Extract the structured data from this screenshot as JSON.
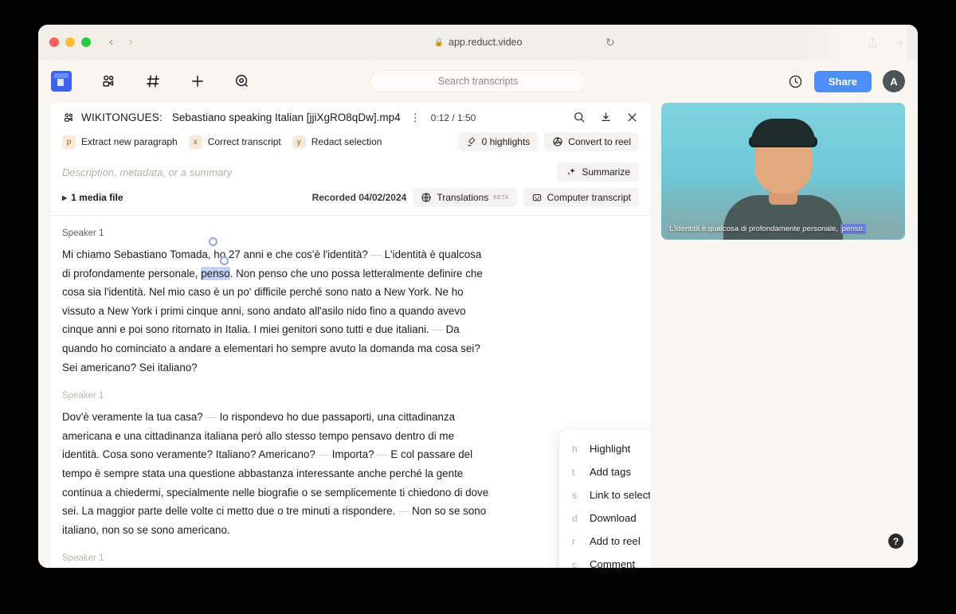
{
  "browser": {
    "url": "app.reduct.video",
    "lock_icon": "lock-icon",
    "back_icon": "chevron-left-icon",
    "forward_icon": "chevron-right-icon",
    "reload_icon": "reload-icon",
    "share_icon": "share-icon",
    "newtab_icon": "plus-icon"
  },
  "app_header": {
    "logo_name": "reduct-logo",
    "icons": [
      "team-icon",
      "hash-icon",
      "plus-icon",
      "explore-icon"
    ],
    "search_placeholder": "Search transcripts",
    "history_icon": "clock-icon",
    "share_label": "Share",
    "avatar_initial": "A",
    "accent_color": "#4e8ef7"
  },
  "document": {
    "project_prefix": "WIKITONGUES:",
    "file_name": "Sebastiano speaking Italian [jjiXgRO8qDw].mp4",
    "time_current": "0:12",
    "time_total": "1:50",
    "time_display": "0:12 / 1:50",
    "actions": [
      "search-icon",
      "download-icon",
      "close-icon"
    ]
  },
  "shortcuts": [
    {
      "key": "p",
      "label": "Extract new paragraph"
    },
    {
      "key": "x",
      "label": "Correct transcript"
    },
    {
      "key": "y",
      "label": "Redact selection"
    }
  ],
  "toolbar_right": {
    "highlights_label": "0 highlights",
    "highlights_icon": "highlighter-icon",
    "convert_label": "Convert to reel",
    "convert_icon": "reel-icon"
  },
  "description": {
    "placeholder": "Description, metadata, or a summary",
    "summarize_label": "Summarize",
    "summarize_icon": "sparkle-icon"
  },
  "meta": {
    "media_file_label": "1 media file",
    "disclosure_icon": "triangle-right-icon",
    "recorded_label": "Recorded 04/02/2024",
    "translations_label": "Translations",
    "translations_badge": "BETA",
    "translations_icon": "globe-icon",
    "computer_transcript_label": "Computer transcript",
    "computer_transcript_icon": "robot-icon"
  },
  "transcript": {
    "paragraphs": [
      {
        "speaker": "Speaker 1",
        "speaker_dim": false,
        "segments": [
          {
            "text": "Mi chiamo Sebastiano Tomada, ho 27 anni e che cos'è l'identità?",
            "style": "normal"
          },
          {
            "text": " ",
            "style": "gap"
          },
          {
            "text": "L'identità è qualcosa di profondamente personale, ",
            "style": "normal"
          },
          {
            "text": "penso",
            "style": "selected"
          },
          {
            "text": ". Non penso che uno possa letteralmente definire che cosa sia l'identità. Nel mio caso è un po' difficile perché sono nato a New York. Ne ho vissuto a New York i primi cinque anni, sono andato all'asilo nido fino a quando avevo cinque anni e poi sono ritornato in Italia. I miei genitori sono tutti e due italiani.",
            "style": "normal"
          },
          {
            "text": " ",
            "style": "gap"
          },
          {
            "text": "Da quando ho cominciato a andare a elementari ho sempre avuto la domanda ma cosa sei? Sei americano? Sei italiano?",
            "style": "normal"
          }
        ]
      },
      {
        "speaker": "Speaker 1",
        "speaker_dim": true,
        "segments": [
          {
            "text": "Dov'è veramente la tua casa?",
            "style": "normal"
          },
          {
            "text": " ",
            "style": "gap"
          },
          {
            "text": "Io rispondevo ho due passaporti, una cittadinanza americana e una cittadinanza italiana però allo stesso tempo pensavo dentro di me identità. Cosa sono veramente? Italiano? Americano?",
            "style": "normal"
          },
          {
            "text": " ",
            "style": "gap"
          },
          {
            "text": "Importa?",
            "style": "normal"
          },
          {
            "text": " ",
            "style": "gap"
          },
          {
            "text": "E col passare del tempo è sempre stata una questione abbastanza interessante anche perché la gente continua a chiedermi, specialmente nelle biografie o se semplicemente ti chiedono di dove sei. La maggior parte delle volte ci metto due o tre minuti a rispondere.",
            "style": "normal"
          },
          {
            "text": " ",
            "style": "gap"
          },
          {
            "text": "Non so se sono italiano, non so se sono americano.",
            "style": "normal"
          }
        ]
      },
      {
        "speaker": "Speaker 1",
        "speaker_dim": true,
        "segments": []
      }
    ],
    "selection_color": "#c3d2f7"
  },
  "context_menu": [
    {
      "key": "h",
      "label": "Highlight"
    },
    {
      "key": "t",
      "label": "Add tags"
    },
    {
      "key": "s",
      "label": "Link to selection"
    },
    {
      "key": "d",
      "label": "Download"
    },
    {
      "key": "r",
      "label": "Add to reel"
    },
    {
      "key": "c",
      "label": "Comment"
    }
  ],
  "video": {
    "caption_before": "L'identità è qualcosa di profondamente personale, ",
    "caption_highlight": "penso.",
    "caption_highlight_color": "#6b7fd9"
  },
  "help": {
    "icon": "question-mark-icon",
    "label": "?"
  }
}
